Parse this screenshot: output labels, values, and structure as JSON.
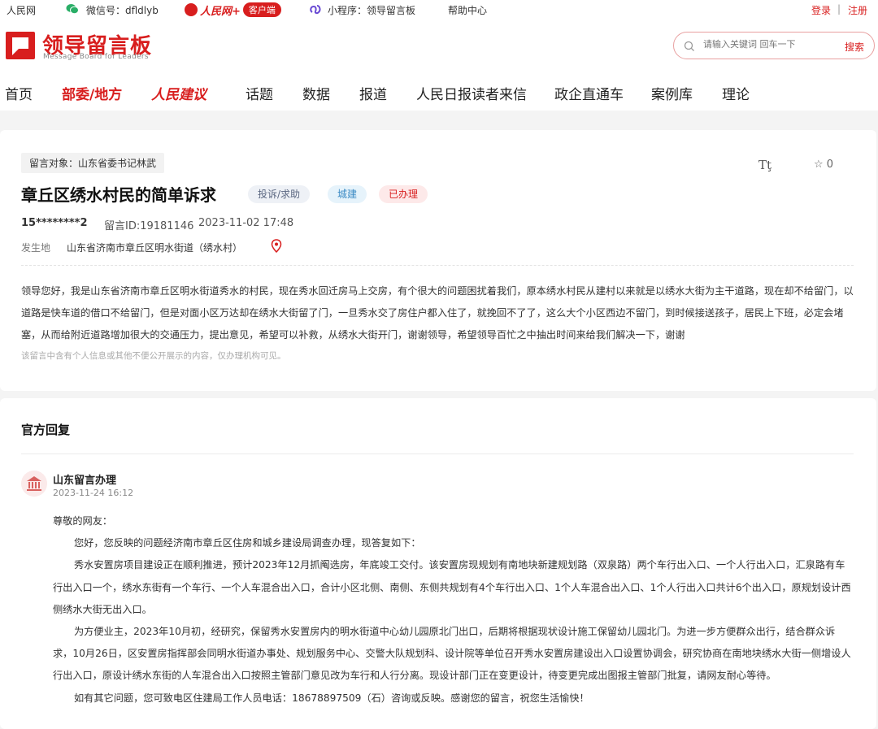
{
  "topbar": {
    "site": "人民网",
    "wechat": "微信号：dfldlyb",
    "brand": "人民网+",
    "client_badge": "客户端",
    "miniprogram": "小程序：领导留言板",
    "help": "帮助中心",
    "login": "登录",
    "separator": "|",
    "register": "注册"
  },
  "header": {
    "logo_title": "领导留言板",
    "logo_subtitle": "Message Board for Leaders",
    "search_placeholder": "请输入关键词 回车一下",
    "search_button": "搜索"
  },
  "nav": {
    "items": [
      "首页",
      "部委/地方",
      "人民建议",
      "话题",
      "数据",
      "报道",
      "人民日报读者来信",
      "政企直通车",
      "案例库",
      "理论"
    ],
    "active": "部委/地方"
  },
  "message": {
    "target": "留言对象：山东省委书记林武",
    "font_toggle": "Tţ",
    "favorites": "0",
    "title": "章丘区绣水村民的简单诉求",
    "tags": [
      "投诉/求助",
      "城建",
      "已办理"
    ],
    "user": "15********2",
    "id": "留言ID:19181146",
    "time": "2023-11-02 17:48",
    "location_label": "发生地",
    "location": "山东省济南市章丘区明水街道（绣水村）",
    "content": "领导您好，我是山东省济南市章丘区明水街道秀水的村民，现在秀水回迁房马上交房，有个很大的问题困扰着我们，原本绣水村民从建村以来就是以绣水大街为主干道路，现在却不给留门，以道路是快车道的借口不给留门，但是对面小区万达却在绣水大街留了门，一旦秀水交了房住户都入住了，就挽回不了了，这么大个小区西边不留门，到时候接送孩子，居民上下班，必定会堵塞，从而给附近道路增加很大的交通压力，提出意见，希望可以补救，从绣水大街开门，谢谢领导，希望领导百忙之中抽出时间来给我们解决一下，谢谢",
    "privacy_note": "该留言中含有个人信息或其他不便公开展示的内容，仅办理机构可见。"
  },
  "reply": {
    "section_title": "官方回复",
    "org": "山东留言办理",
    "time": "2023-11-24 16:12",
    "greeting": "尊敬的网友：",
    "paragraphs": [
      "您好，您反映的问题经济南市章丘区住房和城乡建设局调查办理，现答复如下：",
      "秀水安置房项目建设正在顺利推进，预计2023年12月抓阄选房，年底竣工交付。该安置房现规划有南地块新建规划路（双泉路）两个车行出入口、一个人行出入口，汇泉路有车行出入口一个，绣水东街有一个车行、一个人车混合出入口，合计小区北侧、南侧、东侧共规划有4个车行出入口、1个人车混合出入口、1个人行出入口共计6个出入口，原规划设计西侧绣水大街无出入口。",
      "为方便业主，2023年10月初，经研究，保留秀水安置房内的明水街道中心幼儿园原北门出口，后期将根据现状设计施工保留幼儿园北门。为进一步方便群众出行，结合群众诉求，10月26日，区安置房指挥部会同明水街道办事处、规划服务中心、交警大队规划科、设计院等单位召开秀水安置房建设出入口设置协调会，研究协商在南地块绣水大街一侧增设人行出入口，原设计绣水东街的人车混合出入口按照主管部门意见改为车行和人行分离。现设计部门正在变更设计，待变更完成出图报主管部门批复，请网友耐心等待。",
      "如有其它问题，您可致电区住建局工作人员电话：18678897509（石）咨询或反映。感谢您的留言，祝您生活愉快！"
    ]
  },
  "colors": {
    "accent": "#d81e1e",
    "background": "#f4f4f4"
  }
}
